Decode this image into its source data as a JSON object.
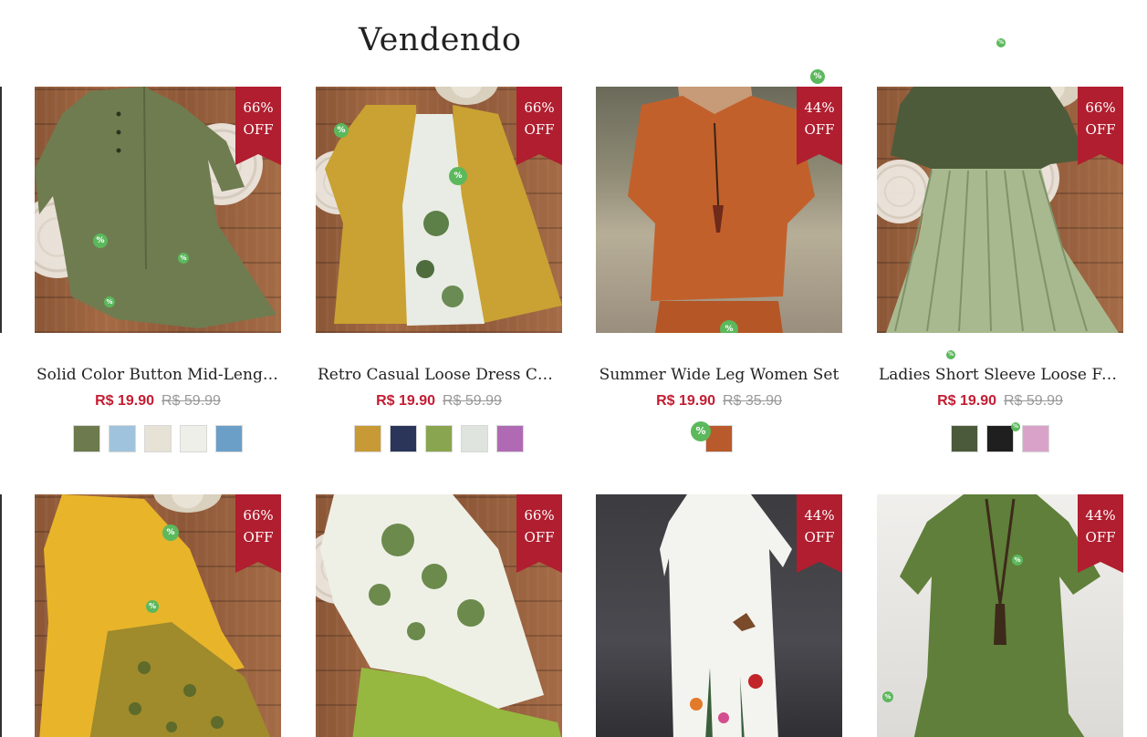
{
  "section": {
    "title": "Vendendo"
  },
  "products": [
    {
      "name": "Solid Color Button Mid-Length Casual Dress",
      "badge_pct": "66%",
      "badge_off": "OFF",
      "price": "R$ 19.90",
      "old_price": "R$ 59.99",
      "swatches": [
        "#6d7a4d",
        "#9fc3dc",
        "#e7e2d6",
        "#efefe9",
        "#6b9fc8"
      ]
    },
    {
      "name": "Retro Casual Loose Dress Cardigan",
      "badge_pct": "66%",
      "badge_off": "OFF",
      "price": "R$ 19.90",
      "old_price": "R$ 59.99",
      "swatches": [
        "#c79a36",
        "#2b3559",
        "#8aa54f",
        "#dfe4de",
        "#b06ab4"
      ]
    },
    {
      "name": "Summer Wide Leg Women Set",
      "badge_pct": "44%",
      "badge_off": "OFF",
      "price": "R$ 19.90",
      "old_price": "R$ 35.90",
      "swatches": [
        "#b85a2b"
      ]
    },
    {
      "name": "Ladies Short Sleeve Loose Fashion Dress",
      "badge_pct": "66%",
      "badge_off": "OFF",
      "price": "R$ 19.90",
      "old_price": "R$ 59.99",
      "swatches": [
        "#4b5a3b",
        "#1f1f1f",
        "#d9a3c9"
      ]
    },
    {
      "name": "",
      "badge_pct": "66%",
      "badge_off": "OFF"
    },
    {
      "name": "",
      "badge_pct": "66%",
      "badge_off": "OFF"
    },
    {
      "name": "",
      "badge_pct": "44%",
      "badge_off": "OFF"
    },
    {
      "name": "",
      "badge_pct": "44%",
      "badge_off": "OFF"
    }
  ],
  "decor": {
    "percent_glyph": "%"
  }
}
